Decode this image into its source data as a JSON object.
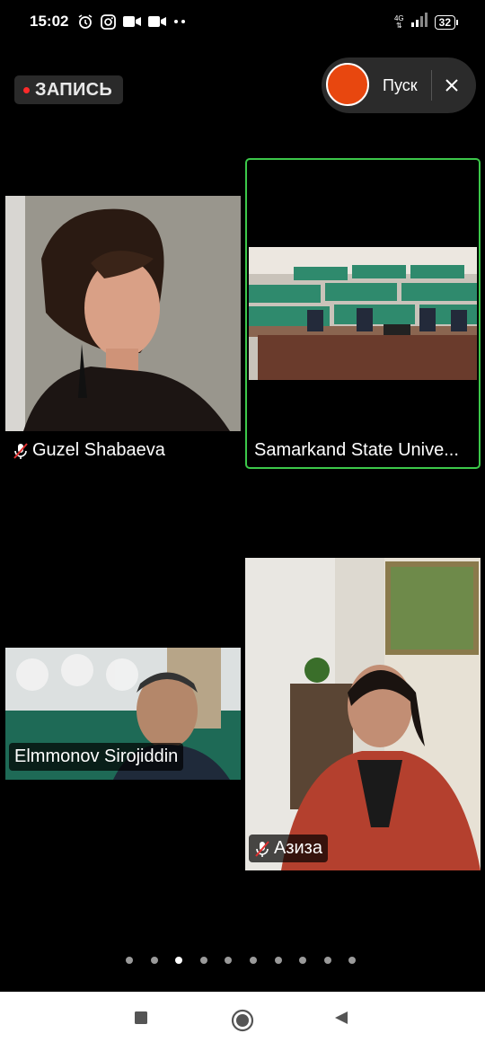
{
  "status_bar": {
    "time": "15:02",
    "icons": [
      "alarm-icon",
      "instagram-icon",
      "video-icon",
      "video-icon",
      "more-dots-icon"
    ],
    "network": "4G",
    "battery": "32"
  },
  "recording": {
    "label": "ЗАПИСЬ",
    "dot_color": "#ff2a2a"
  },
  "start_control": {
    "label": "Пуск",
    "button_color": "#e8470f"
  },
  "participants": [
    {
      "name": "Guzel Shabaeva",
      "muted": true
    },
    {
      "name": "Samarkand State Unive...",
      "muted": false,
      "active_speaker": true
    },
    {
      "name": "Elmmonov Sirojiddin",
      "muted": false
    },
    {
      "name": "Азиза",
      "muted": true
    }
  ],
  "colors": {
    "active_border": "#3cc84a",
    "background": "#000000"
  },
  "pager": {
    "count": 10,
    "active_index": 2
  },
  "nav": [
    "recent-apps-square-icon",
    "home-circle-icon",
    "back-triangle-icon"
  ]
}
